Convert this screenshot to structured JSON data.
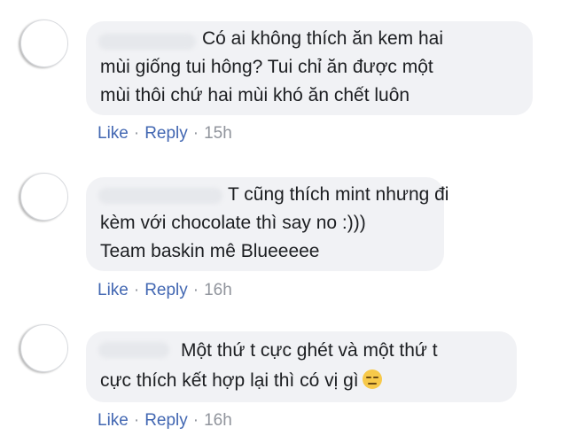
{
  "comments": [
    {
      "text_lines": [
        "Có ai không thích ăn kem hai",
        "mùi giống tui hông? Tui chỉ ăn được một",
        "mùi thôi chứ hai mùi khó ăn chết luôn"
      ],
      "like_label": "Like",
      "reply_label": "Reply",
      "separator": "·",
      "timestamp": "15h"
    },
    {
      "text_lines": [
        "T cũng thích mint nhưng đi",
        "kèm với chocolate thì say no :)))",
        "Team baskin mê Blueeeee"
      ],
      "like_label": "Like",
      "reply_label": "Reply",
      "separator": "·",
      "timestamp": "16h"
    },
    {
      "text_lines": [
        "Một thứ t cực ghét và một thứ t",
        "cực thích kết hợp lại thì có vị gì"
      ],
      "emoji": "expressionless-face-icon",
      "like_label": "Like",
      "reply_label": "Reply",
      "separator": "·",
      "timestamp": "16h"
    }
  ],
  "colors": {
    "bubble_background": "#f1f2f5",
    "link": "#4267b2",
    "meta_text": "#90949c",
    "body_text": "#1c1e21"
  }
}
